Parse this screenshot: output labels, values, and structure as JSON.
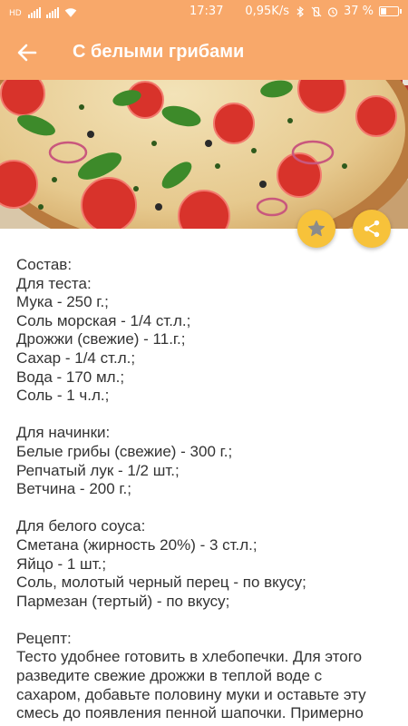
{
  "status": {
    "time": "17:37",
    "net_speed": "0,95K/s",
    "battery": "37 %",
    "battery_level": 0.37,
    "sim_label": "HD"
  },
  "toolbar": {
    "title": "С белыми грибами"
  },
  "hero": {
    "image_subject": "pizza-photo"
  },
  "actions": {
    "favorite_icon": "star-icon",
    "share_icon": "share-icon"
  },
  "colors": {
    "accent": "#f8a86a",
    "fab": "#f7c23a",
    "text": "#333333"
  },
  "recipe": {
    "ingredients_heading": "Состав:",
    "dough_heading": "Для теста:",
    "dough": [
      "Мука - 250 г.;",
      "Соль морская - 1/4 ст.л.;",
      "Дрожжи (свежие) - 11.г.;",
      "Сахар - 1/4 ст.л.;",
      "Вода - 170 мл.;",
      "Соль - 1 ч.л.;"
    ],
    "filling_heading": "Для начинки:",
    "filling": [
      "Белые грибы (свежие) - 300 г.;",
      "Репчатый лук - 1/2 шт.;",
      "Ветчина - 200 г.;"
    ],
    "sauce_heading": "Для белого соуса:",
    "sauce": [
      "Сметана (жирность 20%) - 3 ст.л.;",
      "Яйцо - 1 шт.;",
      "Соль, молотый черный перец - по вкусу;",
      "Пармезан (тертый) - по вкусу;"
    ],
    "method_heading": "Рецепт:",
    "method_lines": [
      "Тесто удобнее готовить в хлебопечки. Для этого",
      "разведите свежие дрожжи в теплой воде с",
      "сахаром, добавьте половину муки и оставьте эту",
      "смесь до появления пенной шапочки. Примерно"
    ]
  }
}
